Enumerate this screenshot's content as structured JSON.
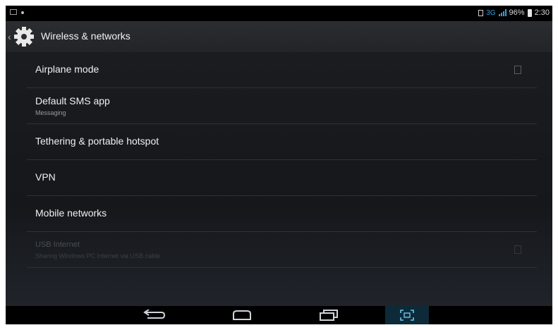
{
  "status_bar": {
    "network": "3G",
    "battery": "96%",
    "time": "2:30"
  },
  "action_bar": {
    "icon": "gear-icon",
    "title": "Wireless & networks"
  },
  "settings": {
    "items": [
      {
        "label": "Airplane mode",
        "has_checkbox": true,
        "checked": false
      },
      {
        "label": "Default SMS app",
        "summary": "Messaging"
      },
      {
        "label": "Tethering & portable hotspot"
      },
      {
        "label": "VPN"
      },
      {
        "label": "Mobile networks"
      },
      {
        "label": "USB Internet",
        "summary": "Sharing Windows PC Internet via USB cable",
        "disabled": true,
        "has_checkbox": true,
        "checked": false
      }
    ]
  },
  "nav_bar": {
    "buttons": [
      "back-icon",
      "home-icon",
      "recent-apps-icon",
      "screenshot-icon"
    ]
  },
  "colors": {
    "background": "#15171b",
    "accent": "#33a0d8",
    "text": "#f0f0f0"
  }
}
